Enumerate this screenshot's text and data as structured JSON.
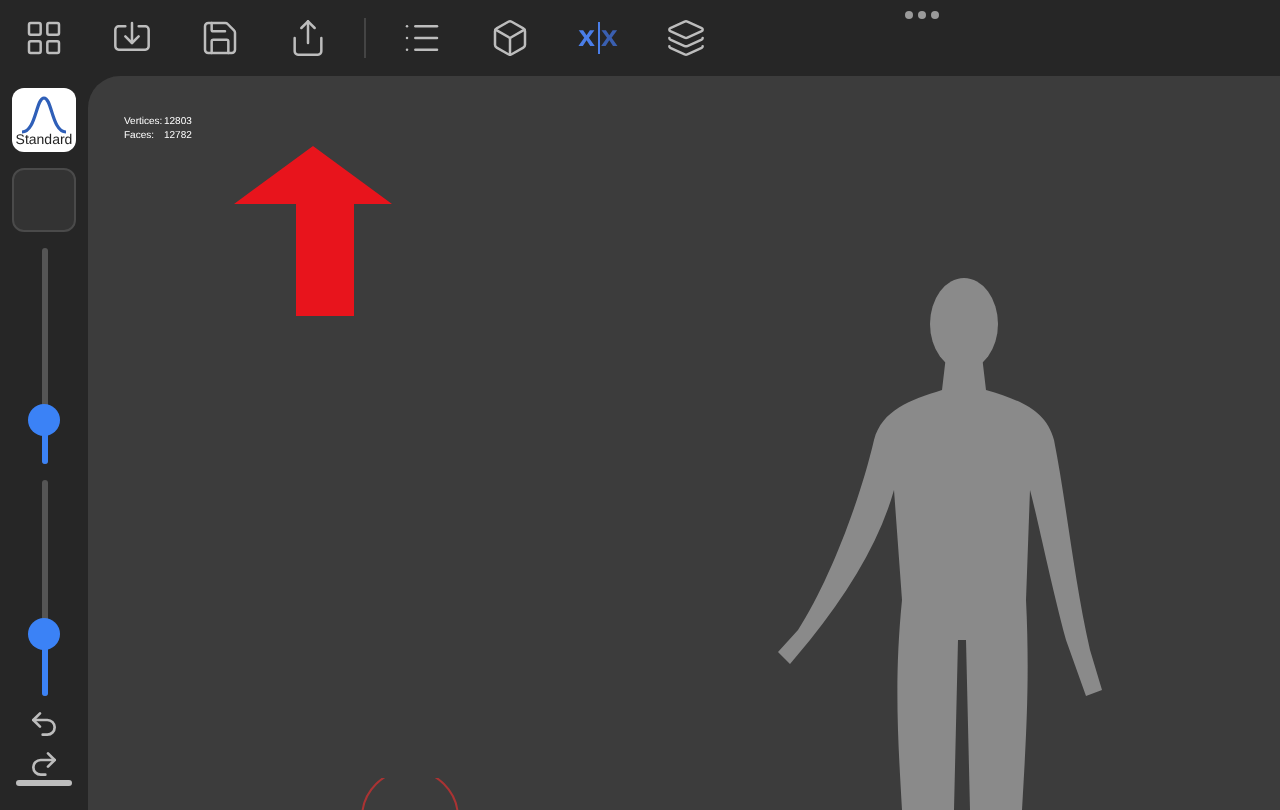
{
  "toolbar": {
    "symmetry": {
      "left": "x",
      "right": "x",
      "on": true
    }
  },
  "sidebar": {
    "material": {
      "label": "Standard"
    },
    "sliders": [
      {
        "level": 0.2
      },
      {
        "level": 0.29
      }
    ]
  },
  "stats": [
    {
      "label": "Vertices:",
      "value": "12803"
    },
    {
      "label": "Faces:",
      "value": "12782"
    }
  ]
}
